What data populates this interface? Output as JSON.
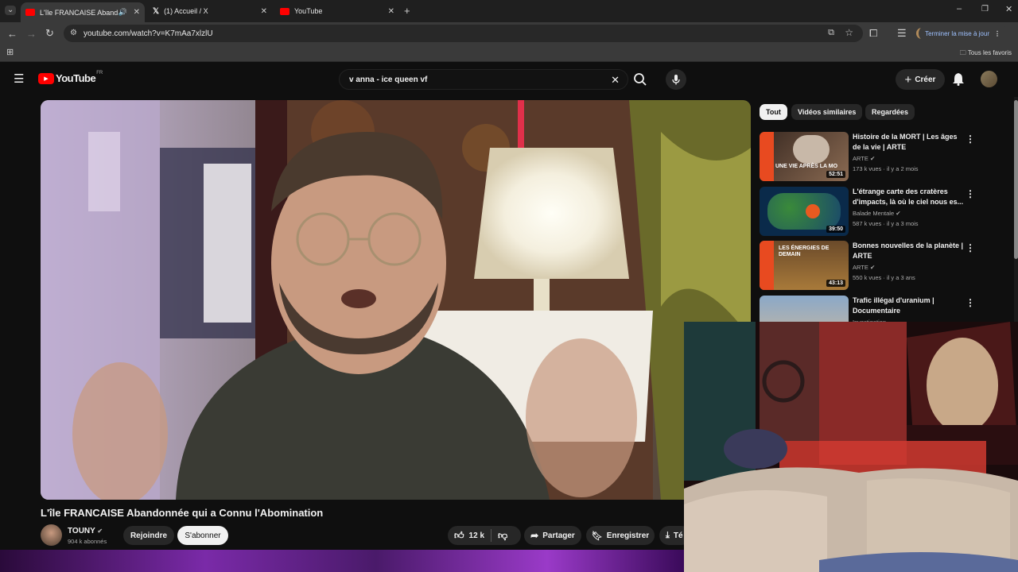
{
  "browser": {
    "tabs": [
      {
        "title": "L'île FRANCAISE Abandonné",
        "active": true
      },
      {
        "title": "(1) Accueil / X",
        "active": false
      },
      {
        "title": "YouTube",
        "active": false
      }
    ],
    "url": "youtube.com/watch?v=K7mAa7xlzlU",
    "update_label": "Terminer la mise à jour",
    "bookmarks_label": "Tous les favoris"
  },
  "youtube": {
    "logo": "YouTube",
    "region": "FR",
    "search_value": "v anna - ice queen vf",
    "create_label": "Créer"
  },
  "video": {
    "title": "L'île FRANCAISE Abandonnée qui a Connu l'Abomination",
    "channel": "TOUNY",
    "subscribers": "904 k abonnés",
    "join_label": "Rejoindre",
    "subscribe_label": "S'abonner",
    "likes": "12 k",
    "share_label": "Partager",
    "save_label": "Enregistrer",
    "download_label": "Té"
  },
  "filters": [
    "Tout",
    "Vidéos similaires",
    "Regardées"
  ],
  "recommendations": [
    {
      "title": "Histoire de la MORT | Les âges de la vie | ARTE",
      "channel": "ARTE",
      "meta": "173 k vues · il y a 2 mois",
      "duration": "52:51",
      "thumb_text": "UNE VIE APRÈS LA MO"
    },
    {
      "title": "L'étrange carte des cratères d'impacts, là où le ciel nous es...",
      "channel": "Balade Mentale",
      "meta": "587 k vues · il y a 3 mois",
      "duration": "39:50",
      "thumb_text": ""
    },
    {
      "title": "Bonnes nouvelles de la planète | ARTE",
      "channel": "ARTE",
      "meta": "550 k vues · il y a 3 ans",
      "duration": "43:13",
      "thumb_text": "LES ÉNERGIES DE DEMAIN"
    },
    {
      "title": "Trafic illégal d'uranium | Documentaire",
      "channel": "Investigation",
      "meta": "",
      "duration": "",
      "thumb_text": ""
    }
  ]
}
